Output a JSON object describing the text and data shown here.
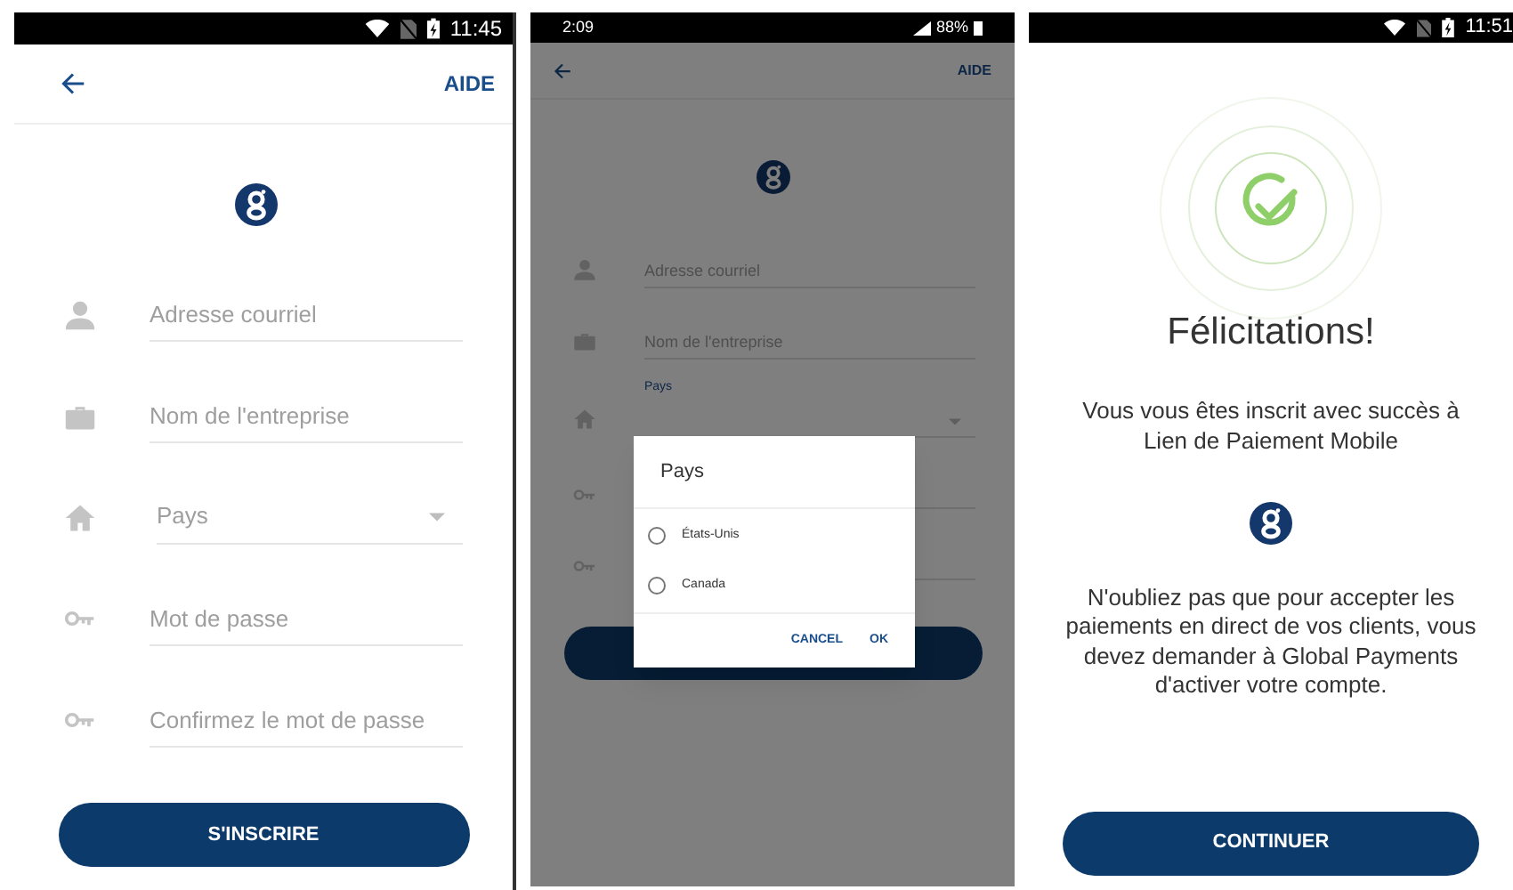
{
  "signup_screen": {
    "status_bar": {
      "time": "11:45"
    },
    "header": {
      "help": "AIDE"
    },
    "fields": [
      {
        "kind": "text",
        "placeholder": "Adresse courriel"
      },
      {
        "kind": "text",
        "placeholder": "Nom de l'entreprise"
      },
      {
        "kind": "dropdown",
        "placeholder": "Pays"
      },
      {
        "kind": "text",
        "placeholder": "Mot de passe"
      },
      {
        "kind": "text",
        "placeholder": "Confirmez le mot de passe"
      }
    ],
    "submit": "S'INSCRIRE"
  },
  "country_dialog_screen": {
    "status_bar": {
      "time": "2:09",
      "battery": "88%"
    },
    "header": {
      "help": "AIDE"
    },
    "fields": [
      {
        "kind": "text",
        "placeholder": "Adresse courriel"
      },
      {
        "kind": "text",
        "placeholder": "Nom de l'entreprise"
      },
      {
        "kind": "dropdown",
        "label": "Pays"
      },
      {
        "kind": "text"
      },
      {
        "kind": "text"
      }
    ],
    "dialog": {
      "title": "Pays",
      "options": [
        {
          "label": "États-Unis",
          "selected": false
        },
        {
          "label": "Canada",
          "selected": false
        }
      ],
      "buttons": [
        "CANCEL",
        "OK"
      ]
    }
  },
  "success_screen": {
    "status_bar": {
      "time": "11:51"
    },
    "title": "Félicitations!",
    "message": "Vous vous êtes inscrit avec succès à Lien de Paiement Mobile",
    "note": "N'oubliez pas que pour accepter les paiements en direct de vos clients, vous devez demander à Global Payments d'activer votre compte.",
    "continue": "CONTINUER"
  }
}
